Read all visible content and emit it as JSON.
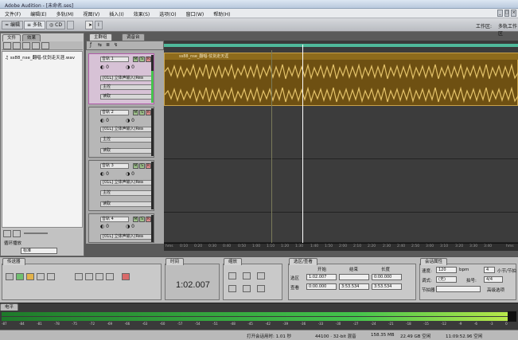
{
  "app": {
    "title": "Adobe Audition - [未命名.ses]"
  },
  "menu": [
    "文件(F)",
    "编辑(E)",
    "多轨(M)",
    "视图(V)",
    "插入(I)",
    "效果(S)",
    "选项(O)",
    "窗口(W)",
    "帮助(H)"
  ],
  "toolbar": {
    "edit_label": "编辑",
    "multitrack_label": "多轨",
    "cd_label": "CD",
    "workspace_label": "工作区:",
    "workspace_value": "多轨工作区"
  },
  "files_panel": {
    "tab_files": "文件",
    "tab_effects": "效果",
    "item_label": "ss88_nse_翻唱-仗剑走天涯.wav",
    "loop_label": "循环播放",
    "fx_label": "标准"
  },
  "main_tabs": {
    "main": "主群组",
    "mixer": "调音台"
  },
  "tracks": [
    {
      "name": "音轨 1",
      "input": "[01L] 立体声输入(Rea",
      "out": "主控",
      "auto": "读取"
    },
    {
      "name": "音轨 2",
      "input": "[01L] 立体声输入(Rea",
      "out": "主控",
      "auto": "读取"
    },
    {
      "name": "音轨 3",
      "input": "[01L] 立体声输入(Rea",
      "out": "主控",
      "auto": "读取"
    },
    {
      "name": "音轨 4",
      "input": "[01L] 立体声输入(Rea",
      "out": "主控",
      "auto": "读取"
    }
  ],
  "clip": {
    "label": "ss88_nse_翻唱-仗剑走天涯"
  },
  "ruler": [
    "hms",
    "0:10",
    "0:20",
    "0:30",
    "0:40",
    "0:50",
    "1:00",
    "1:10",
    "1:20",
    "1:30",
    "1:40",
    "1:50",
    "2:00",
    "2:10",
    "2:20",
    "2:30",
    "2:40",
    "2:50",
    "3:00",
    "3:10",
    "3:20",
    "3:30",
    "3:40",
    "hms"
  ],
  "transport": {
    "tab": "传送器"
  },
  "time": {
    "tab": "时间",
    "value": "1:02.007"
  },
  "zoom": {
    "tab": "缩放"
  },
  "selection": {
    "tab": "选区/查看",
    "col_start": "开始",
    "col_end": "结束",
    "col_len": "长度",
    "row_sel": "选区",
    "row_view": "查看",
    "sel_start": "1:02.007",
    "sel_end": "",
    "sel_len": "0:00.000",
    "view_start": "0:00.000",
    "view_end": "3:53.534",
    "view_len": "3:53.534"
  },
  "session": {
    "tab": "会话属性",
    "tempo_label": "速度:",
    "tempo_value": "120",
    "tempo_unit": "bpm",
    "beats_value": "4",
    "beats_label": "小节/节拍",
    "key_label": "调式:",
    "key_value": "(无)",
    "meter_label": "拍号:",
    "meter_value": "4/4",
    "metronome_label": "节拍器",
    "advanced_label": "高级选项"
  },
  "levels": {
    "tab": "电平",
    "ticks": [
      "-87",
      "-84",
      "-81",
      "-78",
      "-75",
      "-72",
      "-69",
      "-66",
      "-63",
      "-60",
      "-57",
      "-54",
      "-51",
      "-48",
      "-45",
      "-42",
      "-39",
      "-36",
      "-33",
      "-30",
      "-27",
      "-24",
      "-21",
      "-18",
      "-15",
      "-12",
      "-9",
      "-6",
      "-3",
      "0"
    ]
  },
  "status": {
    "opened": "打开会话用时: 1.01 秒",
    "rate": "44100 · 32-bit 混音",
    "size": "158.35 MB",
    "disk": "22.49 GB 空闲",
    "time": "11:09:52.96 空闲"
  },
  "colors": {
    "waveform": "#e4c36a",
    "clip_bg": "#7a5a14",
    "selected_track": "#c15bb5",
    "meter_green": "#44c44c",
    "playhead": "#ffffff"
  }
}
